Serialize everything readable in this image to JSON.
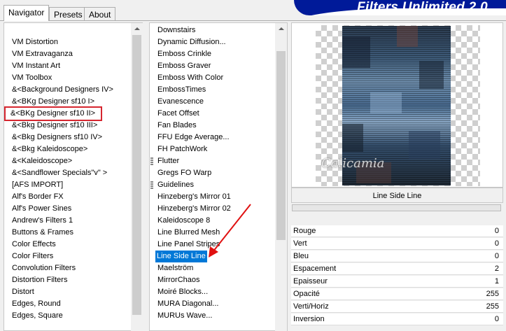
{
  "tabs": [
    {
      "label": "Navigator",
      "active": true
    },
    {
      "label": "Presets",
      "active": false
    },
    {
      "label": "About",
      "active": false
    }
  ],
  "banner": {
    "title": "Filters Unlimited 2.0",
    "color": "#001a99"
  },
  "categories": {
    "items": [
      "VM Distortion",
      "VM Extravaganza",
      "VM Instant Art",
      "VM Toolbox",
      "&<Background Designers IV>",
      "&<BKg Designer sf10 I>",
      "&<BKg Designer sf10 II>",
      "&<Bkg Designer sf10 III>",
      "&<Bkg Designers sf10 IV>",
      "&<Bkg Kaleidoscope>",
      "&<Kaleidoscope>",
      "&<Sandflower Specials\"v\" >",
      "[AFS IMPORT]",
      "Alf's Border FX",
      "Alf's Power Sines",
      "Andrew's Filters 1",
      "Buttons & Frames",
      "Color Effects",
      "Color Filters",
      "Convolution Filters",
      "Distortion Filters",
      "Distort",
      "Edges, Round",
      "Edges, Square"
    ],
    "highlighted": "&<BKg Designer sf10 II>",
    "highlight_color": "#d6262f"
  },
  "filters": {
    "items": [
      {
        "label": "Downstairs",
        "group": false
      },
      {
        "label": "Dynamic Diffusion...",
        "group": false
      },
      {
        "label": "Emboss Crinkle",
        "group": false
      },
      {
        "label": "Emboss Graver",
        "group": false
      },
      {
        "label": "Emboss With Color",
        "group": false
      },
      {
        "label": "EmbossTimes",
        "group": false
      },
      {
        "label": "Evanescence",
        "group": false
      },
      {
        "label": "Facet Offset",
        "group": false
      },
      {
        "label": "Fan Blades",
        "group": false
      },
      {
        "label": "FFU Edge Average...",
        "group": false
      },
      {
        "label": "FH PatchWork",
        "group": false
      },
      {
        "label": "Flutter",
        "group": true
      },
      {
        "label": "Gregs FO Warp",
        "group": false
      },
      {
        "label": "Guidelines",
        "group": true
      },
      {
        "label": "Hinzeberg's Mirror 01",
        "group": false
      },
      {
        "label": "Hinzeberg's Mirror 02",
        "group": false
      },
      {
        "label": "Kaleidoscope 8",
        "group": false
      },
      {
        "label": "Line Blurred Mesh",
        "group": false
      },
      {
        "label": "Line Panel Stripes",
        "group": false
      },
      {
        "label": "Line Side Line",
        "group": false
      },
      {
        "label": "Maelström",
        "group": false
      },
      {
        "label": "MirrorChaos",
        "group": false
      },
      {
        "label": "Moiré Blocks...",
        "group": false
      },
      {
        "label": "MURA Diagonal...",
        "group": false
      },
      {
        "label": "MURUs Wave...",
        "group": false
      }
    ],
    "selected": "Line Side Line",
    "selected_color": "#0078d7"
  },
  "preview": {
    "watermark": "Calicamia"
  },
  "filter_name": "Line Side Line",
  "params": [
    {
      "label": "Rouge",
      "value": "0"
    },
    {
      "label": "Vert",
      "value": "0"
    },
    {
      "label": "Bleu",
      "value": "0"
    },
    {
      "label": "Espacement",
      "value": "2"
    },
    {
      "label": "Epaisseur",
      "value": "1"
    },
    {
      "label": "Opacité",
      "value": "255"
    },
    {
      "label": "Verti/Horiz",
      "value": "255"
    },
    {
      "label": "Inversion",
      "value": "0"
    }
  ]
}
